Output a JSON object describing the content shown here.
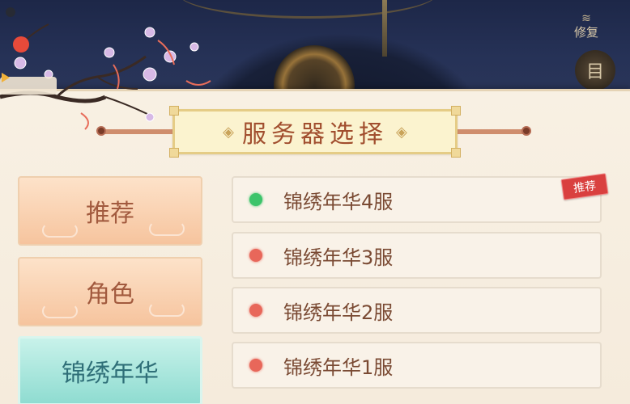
{
  "header": {
    "repair_label": "修复",
    "repair_symbol": "≋",
    "menu_label": "目"
  },
  "title": "服务器选择",
  "tabs": [
    {
      "label": "推荐",
      "active": false
    },
    {
      "label": "角色",
      "active": false
    },
    {
      "label": "锦绣年华",
      "active": true
    }
  ],
  "servers": [
    {
      "name": "锦绣年华4服",
      "status_color": "#3cc46a",
      "badge": "推荐"
    },
    {
      "name": "锦绣年华3服",
      "status_color": "#e8675a"
    },
    {
      "name": "锦绣年华2服",
      "status_color": "#e8675a"
    },
    {
      "name": "锦绣年华1服",
      "status_color": "#e8675a"
    }
  ],
  "colors": {
    "title_text": "#a14e2e",
    "tab_orange": "#f6c49e",
    "tab_active": "#8fdcd1",
    "badge": "#d9403f"
  }
}
